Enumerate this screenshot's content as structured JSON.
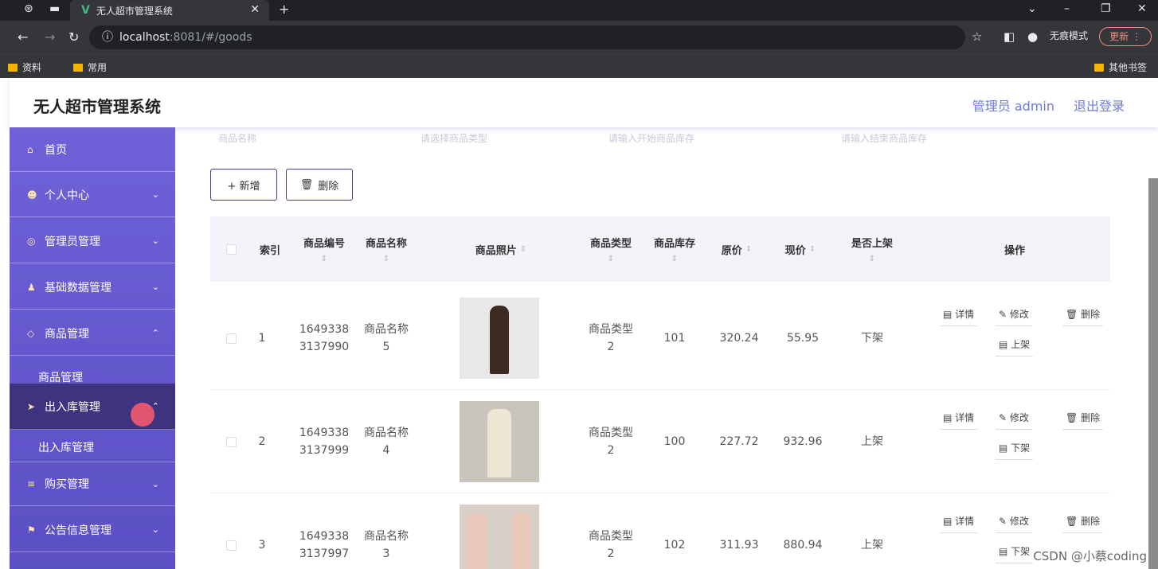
{
  "browser": {
    "tab_title": "无人超市管理系统",
    "url_host": "localhost",
    "url_rest": ":8081/#/goods",
    "incognito_label": "无痕模式",
    "update_label": "更新",
    "bookmarks": [
      "资料",
      "常用"
    ],
    "other_bookmarks": "其他书签"
  },
  "header": {
    "title": "无人超市管理系统",
    "admin_label": "管理员 admin",
    "logout_label": "退出登录"
  },
  "sidebar": {
    "items": [
      {
        "label": "首页"
      },
      {
        "label": "个人中心"
      },
      {
        "label": "管理员管理"
      },
      {
        "label": "基础数据管理"
      },
      {
        "label": "商品管理"
      },
      {
        "label": "出入库管理"
      },
      {
        "label": "购买管理"
      },
      {
        "label": "公告信息管理"
      }
    ],
    "sub_goods": "商品管理",
    "sub_stock": "出入库管理"
  },
  "search": {
    "goods_name_placeholder": "商品名称",
    "goods_type_placeholder": "请选择商品类型",
    "stock_start_placeholder": "请输入开始商品库存",
    "stock_end_placeholder": "请输入结束商品库存"
  },
  "toolbar": {
    "add_label": "+ 新增",
    "delete_label": "删除"
  },
  "table": {
    "headers": {
      "index": "索引",
      "code": "商品编号",
      "name": "商品名称",
      "photo": "商品照片",
      "type": "商品类型",
      "stock": "商品库存",
      "orig_price": "原价",
      "price": "现价",
      "on_shelf": "是否上架",
      "ops": "操作"
    },
    "rows": [
      {
        "index": "1",
        "code_a": "1649338",
        "code_b": "3137990",
        "name_a": "商品名称",
        "name_b": "5",
        "type_a": "商品类型",
        "type_b": "2",
        "stock": "101",
        "orig_price": "320.24",
        "price": "55.95",
        "on_shelf": "下架",
        "detail": "详情",
        "edit": "修改",
        "del": "删除",
        "toggle": "上架"
      },
      {
        "index": "2",
        "code_a": "1649338",
        "code_b": "3137999",
        "name_a": "商品名称",
        "name_b": "4",
        "type_a": "商品类型",
        "type_b": "2",
        "stock": "100",
        "orig_price": "227.72",
        "price": "932.96",
        "on_shelf": "上架",
        "detail": "详情",
        "edit": "修改",
        "del": "删除",
        "toggle": "下架"
      },
      {
        "index": "3",
        "code_a": "1649338",
        "code_b": "3137997",
        "name_a": "商品名称",
        "name_b": "3",
        "type_a": "商品类型",
        "type_b": "2",
        "stock": "102",
        "orig_price": "311.93",
        "price": "880.94",
        "on_shelf": "上架",
        "detail": "详情",
        "edit": "修改",
        "del": "删除",
        "toggle": "下架"
      }
    ]
  },
  "watermark": "CSDN @小蔡coding",
  "colors": {
    "sidebar": "#6f62d8",
    "accent": "#6f7bd9",
    "active": "#3e337f"
  }
}
